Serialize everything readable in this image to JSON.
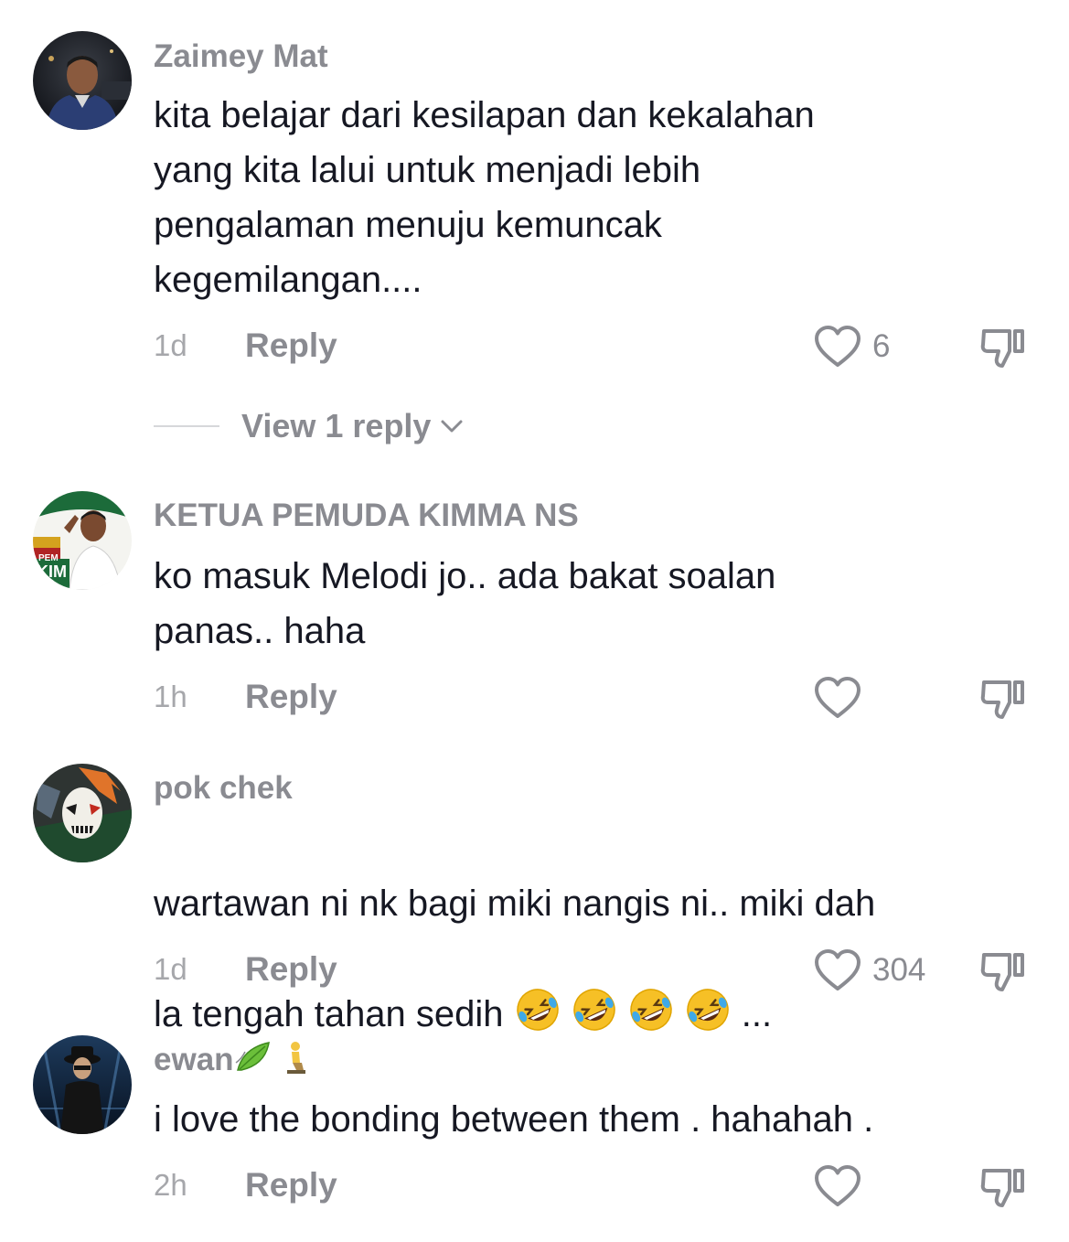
{
  "comments": [
    {
      "username": "Zaimey Mat",
      "text": "kita belajar dari kesilapan dan kekalahan\nyang kita lalui untuk menjadi lebih\npengalaman menuju kemuncak\nkegemilangan....",
      "time": "1d",
      "reply_label": "Reply",
      "likes": "6",
      "view_replies": "View 1 reply",
      "avatar": "man-in-jacket-night-photo"
    },
    {
      "username": "KETUA PEMUDA KIMMA NS",
      "text": "ko masuk Melodi jo.. ada bakat soalan\npanas.. haha",
      "time": "1h",
      "reply_label": "Reply",
      "likes": "",
      "avatar": "kimma-logo-man-photo",
      "avatar_text_1": "PEM",
      "avatar_text_2": "KIM"
    },
    {
      "username": "pok chek",
      "text_line1": "wartawan ni nk bagi miki nangis ni.. miki dah",
      "text_line2": "la tengah tahan sedih",
      "text_suffix": " ...",
      "emojis": [
        "rolling-on-floor-laughing",
        "rolling-on-floor-laughing",
        "rolling-on-floor-laughing",
        "rolling-on-floor-laughing"
      ],
      "time": "1d",
      "reply_label": "Reply",
      "likes": "304",
      "avatar": "anime-masked-character"
    },
    {
      "username": "ewan",
      "username_emojis": [
        "leaf-fluttering-in-wind",
        "person-kneeling"
      ],
      "text": "i love the bonding between them . hahahah .",
      "time": "2h",
      "reply_label": "Reply",
      "likes": "",
      "avatar": "man-in-hat-dark-scene"
    }
  ],
  "colors": {
    "text_primary": "#161823",
    "text_secondary": "#8a8b91",
    "text_tertiary": "#a6a7ab"
  },
  "icons": {
    "like": "heart-outline-icon",
    "dislike": "thumbs-down-outline-icon",
    "expand": "chevron-down-icon"
  }
}
